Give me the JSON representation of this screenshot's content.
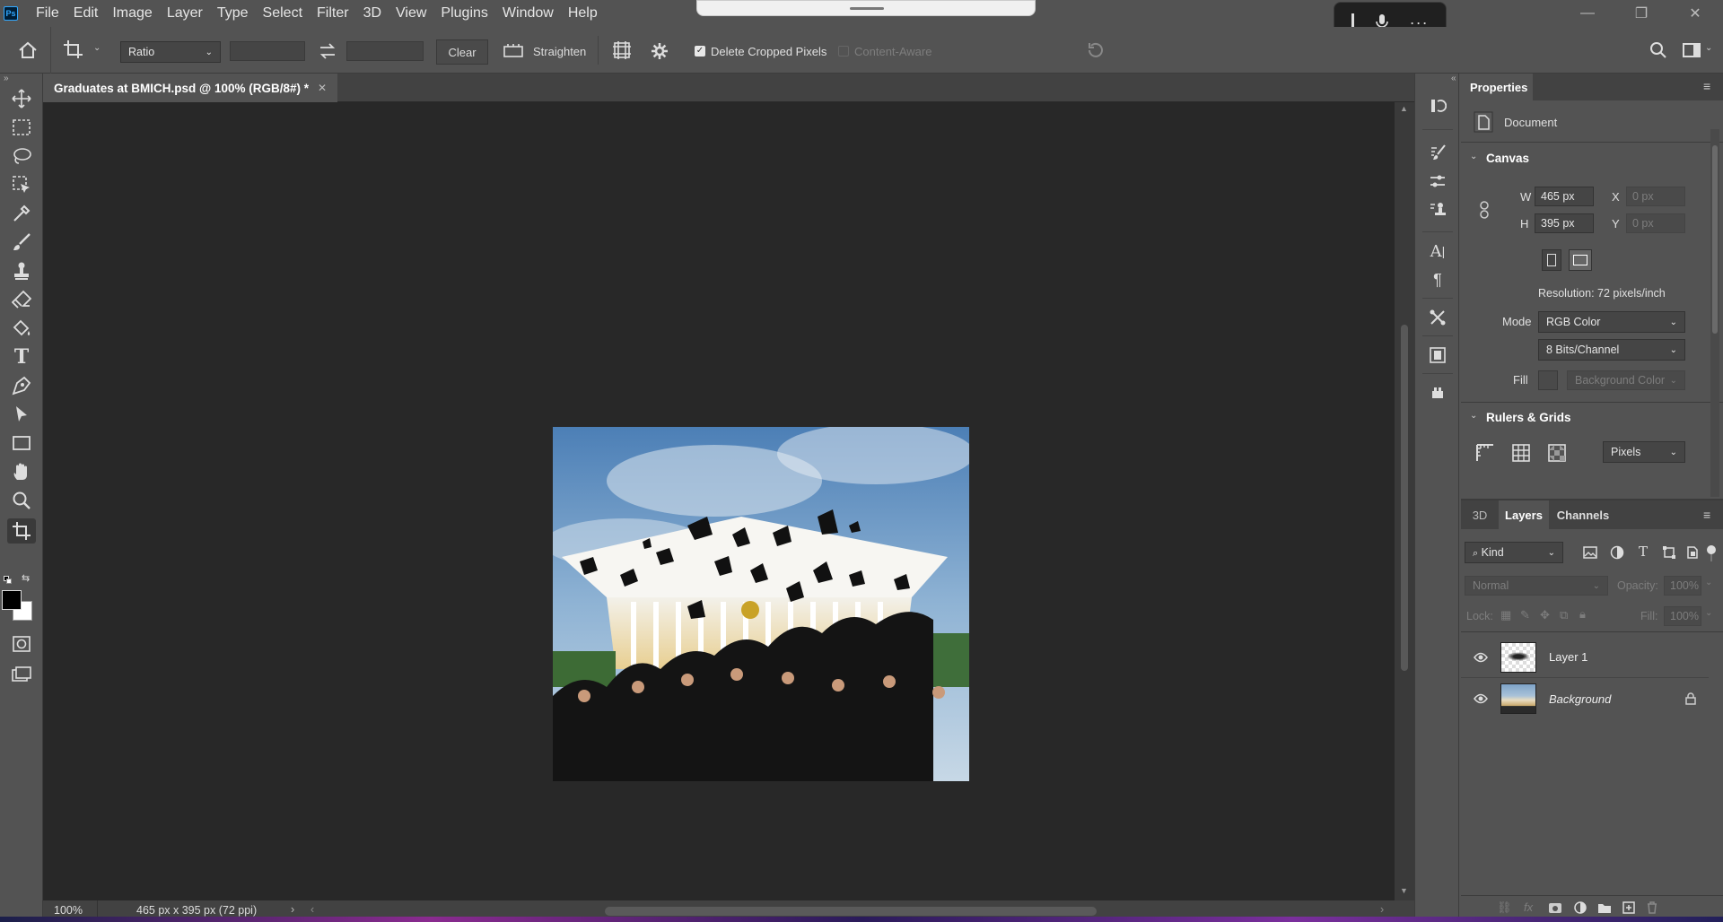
{
  "menubar": {
    "app_badge": "Ps",
    "items": [
      "File",
      "Edit",
      "Image",
      "Layer",
      "Type",
      "Select",
      "Filter",
      "3D",
      "View",
      "Plugins",
      "Window",
      "Help"
    ]
  },
  "options": {
    "ratio_label": "Ratio",
    "clear_label": "Clear",
    "straighten_label": "Straighten",
    "delete_cropped_label": "Delete Cropped Pixels",
    "delete_cropped_checked": true,
    "content_aware_label": "Content-Aware",
    "content_aware_checked": false
  },
  "document": {
    "tab_title": "Graduates at BMICH.psd @ 100% (RGB/8#) *",
    "zoom": "100%",
    "status_info": "465 px x 395 px (72 ppi)"
  },
  "properties": {
    "tab": "Properties",
    "section_doc": "Document",
    "canvas_header": "Canvas",
    "w_label": "W",
    "w_value": "465 px",
    "h_label": "H",
    "h_value": "395 px",
    "x_label": "X",
    "x_value": "0 px",
    "y_label": "Y",
    "y_value": "0 px",
    "resolution": "Resolution: 72 pixels/inch",
    "mode_label": "Mode",
    "mode_value": "RGB Color",
    "bits_value": "8 Bits/Channel",
    "fill_label": "Fill",
    "fill_value": "Background Color",
    "rulers_header": "Rulers & Grids",
    "units_value": "Pixels"
  },
  "layers_panel": {
    "tabs": [
      "3D",
      "Layers",
      "Channels"
    ],
    "active_tab": "Layers",
    "kind_label": "Kind",
    "blend_mode": "Normal",
    "opacity_label": "Opacity:",
    "opacity_value": "100%",
    "lock_label": "Lock:",
    "fill_label": "Fill:",
    "fill_value": "100%",
    "layers": [
      {
        "name": "Layer 1",
        "visible": true,
        "locked": false
      },
      {
        "name": "Background",
        "visible": true,
        "locked": true
      }
    ]
  },
  "colors": {
    "chrome": "#535353",
    "canvas_bg": "#282828",
    "panel_field": "#454545",
    "foreground": "#000000",
    "background": "#ffffff"
  }
}
